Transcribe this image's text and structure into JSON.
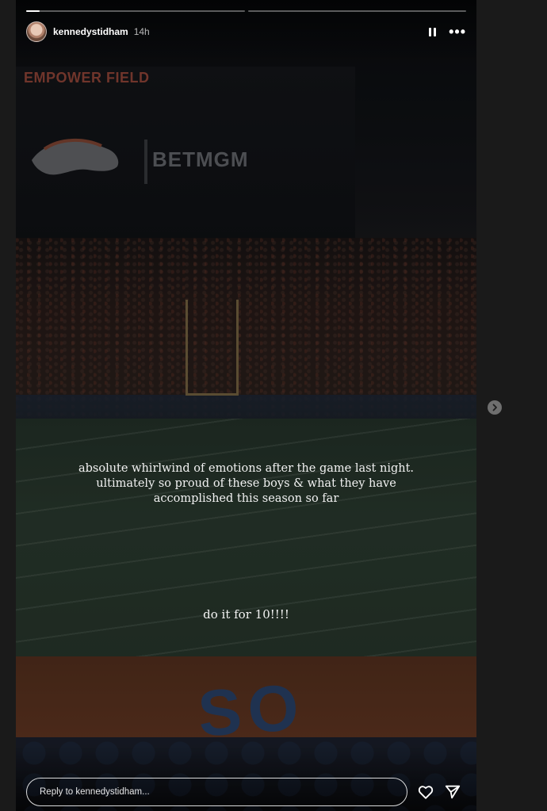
{
  "story": {
    "progress": [
      0.06,
      0.0
    ],
    "header": {
      "username": "kennedystidham",
      "timestamp": "14h",
      "pause_icon": "pause-icon",
      "more_icon": "more-horizontal-icon"
    },
    "scene": {
      "board_top": "EMPOWER FIELD",
      "board_sponsor": "BETMGM",
      "endzone_letters": "SO"
    },
    "caption": {
      "line1": "absolute whirlwind of emotions after the game last night. ultimately so proud of these boys & what they have accomplished this season so far",
      "line2": "do it for 10!!!!"
    },
    "reply": {
      "placeholder": "Reply to kennedystidham...",
      "like_icon": "heart-icon",
      "share_icon": "send-icon"
    }
  },
  "navigation": {
    "next_icon": "chevron-right-icon"
  }
}
